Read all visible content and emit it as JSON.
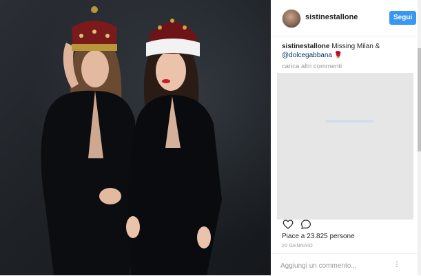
{
  "post": {
    "photo_alt": "Two women in black silk robes wearing jeweled crowns",
    "username": "sistinestallone",
    "follow_label": "Segui",
    "caption": {
      "user": "sistinestallone",
      "text": "Missing Milan &",
      "mention": "@dolcegabbana",
      "emoji": "🌹"
    },
    "load_more_label": "carica altri commenti",
    "likes_label": "Piace a 23.825 persone",
    "date_label": "20 GENNAIO",
    "comment_placeholder": "Aggiungi un commento...",
    "more_icon": "⋮",
    "colors": {
      "follow_button": "#3897f0",
      "mention": "#003569",
      "muted_text": "#999999"
    }
  }
}
